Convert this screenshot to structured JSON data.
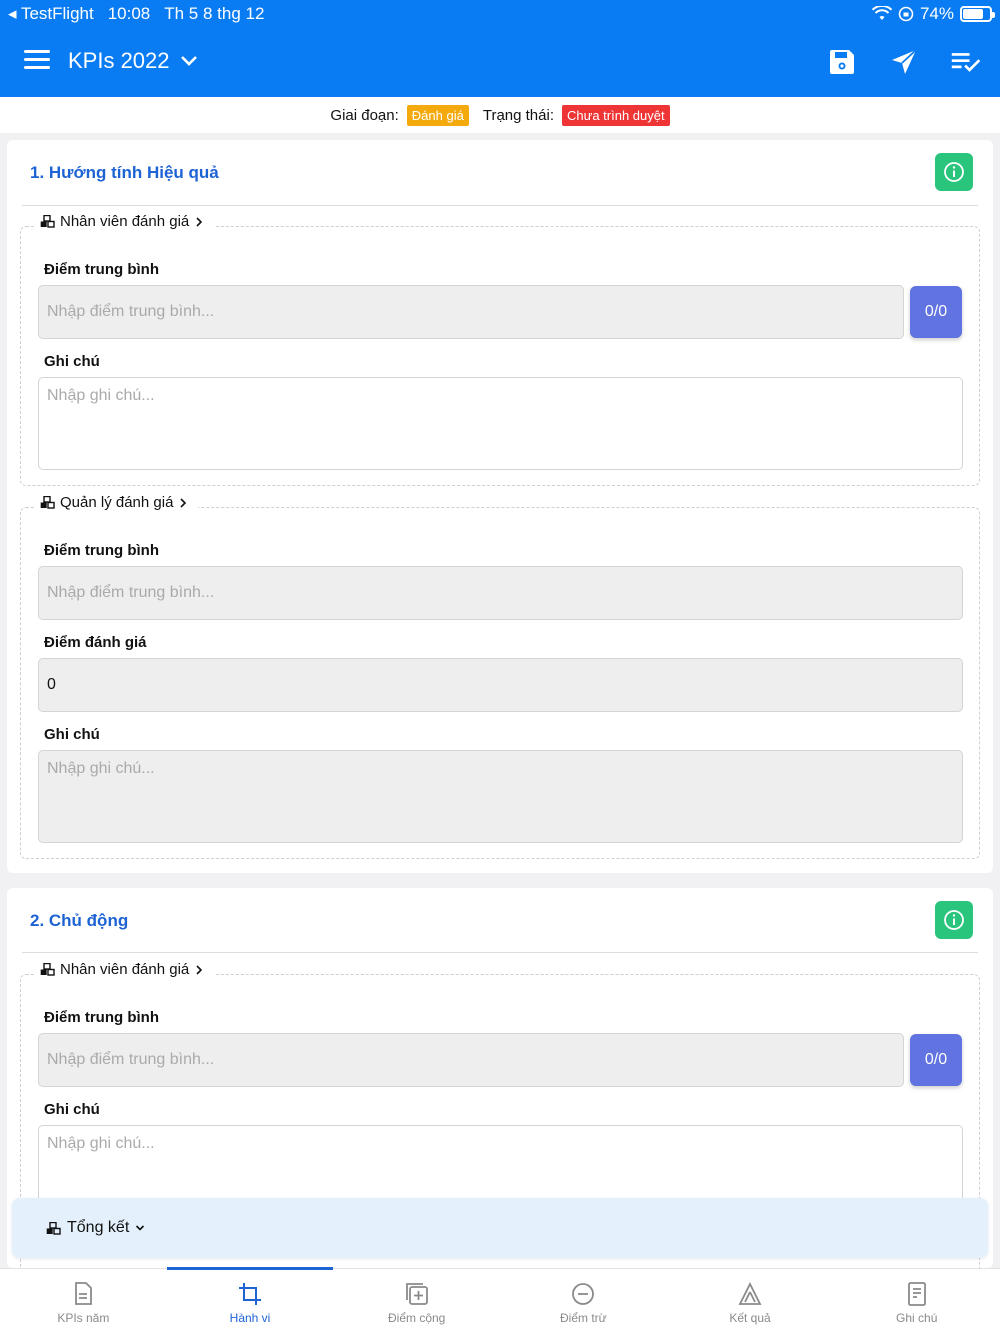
{
  "status_bar": {
    "back_app": "TestFlight",
    "time": "10:08",
    "date": "Th 5 8 thg 12",
    "battery": "74%"
  },
  "navbar": {
    "title": "KPIs 2022",
    "save_icon": "save-icon",
    "send_icon": "send-icon",
    "checklist_icon": "checklist-icon"
  },
  "stage": {
    "phase_label": "Giai đoạn:",
    "phase_value": "Đánh giá",
    "status_label": "Trạng thái:",
    "status_value": "Chưa trình duyệt"
  },
  "cards": [
    {
      "title": "1. Hướng tính Hiệu quả",
      "employee": {
        "legend": "Nhân viên đánh giá",
        "avg_label": "Điểm trung bình",
        "avg_placeholder": "Nhập điểm trung bình...",
        "score": "0/0",
        "note_label": "Ghi chú",
        "note_placeholder": "Nhập ghi chú..."
      },
      "manager": {
        "legend": "Quản lý đánh giá",
        "avg_label": "Điểm trung bình",
        "avg_placeholder": "Nhập điểm trung bình...",
        "rating_label": "Điểm đánh giá",
        "rating_value": "0",
        "note_label": "Ghi chú",
        "note_placeholder": "Nhập ghi chú..."
      }
    },
    {
      "title": "2. Chủ động",
      "employee": {
        "legend": "Nhân viên đánh giá",
        "avg_label": "Điểm trung bình",
        "avg_placeholder": "Nhập điểm trung bình...",
        "score": "0/0",
        "note_label": "Ghi chú",
        "note_placeholder": "Nhập ghi chú..."
      }
    }
  ],
  "summary": {
    "label": "Tổng kết"
  },
  "tabs": [
    {
      "label": "KPIs năm",
      "icon": "document-icon"
    },
    {
      "label": "Hành vi",
      "icon": "crop-icon"
    },
    {
      "label": "Điểm cộng",
      "icon": "plus-square-icon"
    },
    {
      "label": "Điểm trừ",
      "icon": "minus-circle-icon"
    },
    {
      "label": "Kết quả",
      "icon": "result-icon"
    },
    {
      "label": "Ghi chú",
      "icon": "note-icon"
    }
  ],
  "colors": {
    "primary": "#0a7cf3",
    "accent": "#1e63d4",
    "success": "#2ac57d",
    "warning": "#f4a90c",
    "danger": "#ee3434",
    "score_button": "#6073e0"
  }
}
